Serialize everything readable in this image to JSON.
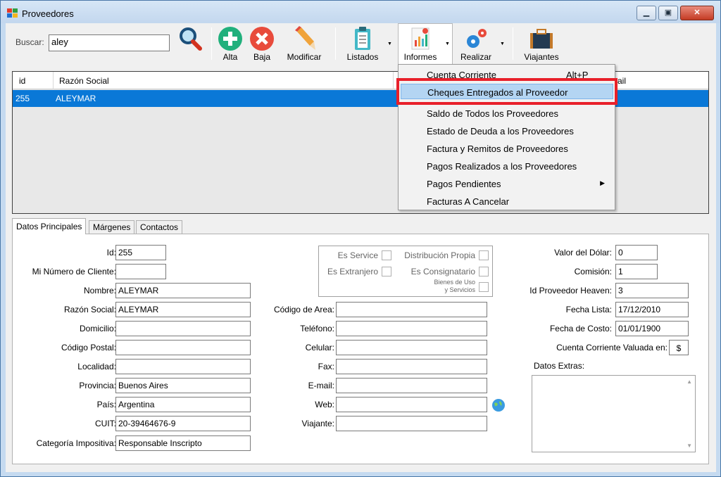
{
  "window": {
    "title": "Proveedores"
  },
  "toolbar": {
    "search_label": "Buscar:",
    "search_value": "aley",
    "alta": "Alta",
    "baja": "Baja",
    "modificar": "Modificar",
    "listados": "Listados",
    "informes": "Informes",
    "realizar": "Realizar",
    "viajantes": "Viajantes"
  },
  "grid": {
    "columns": [
      "id",
      "Razón Social",
      "ail"
    ],
    "rows": [
      {
        "id": "255",
        "razon_social": "ALEYMAR"
      }
    ]
  },
  "menu": {
    "items": [
      {
        "label": "Cuenta Corriente",
        "shortcut": "Alt+P"
      },
      {
        "label": "Cheques Entregados al Proveedor"
      },
      {
        "label": "Saldo de Todos los Proveedores"
      },
      {
        "label": "Estado de Deuda a los Proveedores"
      },
      {
        "label": "Factura y Remitos de Proveedores"
      },
      {
        "label": "Pagos Realizados a los Proveedores"
      },
      {
        "label": "Pagos Pendientes"
      },
      {
        "label": "Facturas A Cancelar"
      }
    ]
  },
  "tabs": [
    "Datos Principales",
    "Márgenes",
    "Contactos"
  ],
  "form": {
    "id": {
      "label": "Id:",
      "value": "255"
    },
    "mi_numero": {
      "label": "Mi Número de Cliente:",
      "value": ""
    },
    "nombre": {
      "label": "Nombre:",
      "value": "ALEYMAR"
    },
    "razon_social": {
      "label": "Razón Social:",
      "value": "ALEYMAR"
    },
    "domicilio": {
      "label": "Domicilio:",
      "value": ""
    },
    "codigo_postal": {
      "label": "Código Postal:",
      "value": ""
    },
    "localidad": {
      "label": "Localidad:",
      "value": ""
    },
    "provincia": {
      "label": "Provincia:",
      "value": "Buenos Aires"
    },
    "pais": {
      "label": "País:",
      "value": "Argentina"
    },
    "cuit": {
      "label": "CUIT:",
      "value": "20-39464676-9"
    },
    "categoria": {
      "label": "Categoría Impositiva:",
      "value": "Responsable Inscripto"
    },
    "es_service": "Es Service",
    "es_extranjero": "Es Extranjero",
    "distribucion_propia": "Distribución Propia",
    "es_consignatario": "Es Consignatario",
    "bienes_1": "Bienes de Uso",
    "bienes_2": "y Servicios",
    "codigo_area": {
      "label": "Código de Area:",
      "value": ""
    },
    "telefono": {
      "label": "Teléfono:",
      "value": ""
    },
    "celular": {
      "label": "Celular:",
      "value": ""
    },
    "fax": {
      "label": "Fax:",
      "value": ""
    },
    "email": {
      "label": "E-mail:",
      "value": ""
    },
    "web": {
      "label": "Web:",
      "value": ""
    },
    "viajante": {
      "label": "Viajante:",
      "value": ""
    },
    "valor_dolar": {
      "label": "Valor del Dólar:",
      "value": "0"
    },
    "comision": {
      "label": "Comisión:",
      "value": "1"
    },
    "id_heaven": {
      "label": "Id Proveedor Heaven:",
      "value": "3"
    },
    "fecha_lista": {
      "label": "Fecha Lista:",
      "value": "17/12/2010"
    },
    "fecha_costo": {
      "label": "Fecha de Costo:",
      "value": "01/01/1900"
    },
    "cta_cte_valuada": {
      "label": "Cuenta Corriente Valuada en:",
      "value": "$"
    },
    "datos_extras": {
      "label": "Datos Extras:"
    }
  }
}
